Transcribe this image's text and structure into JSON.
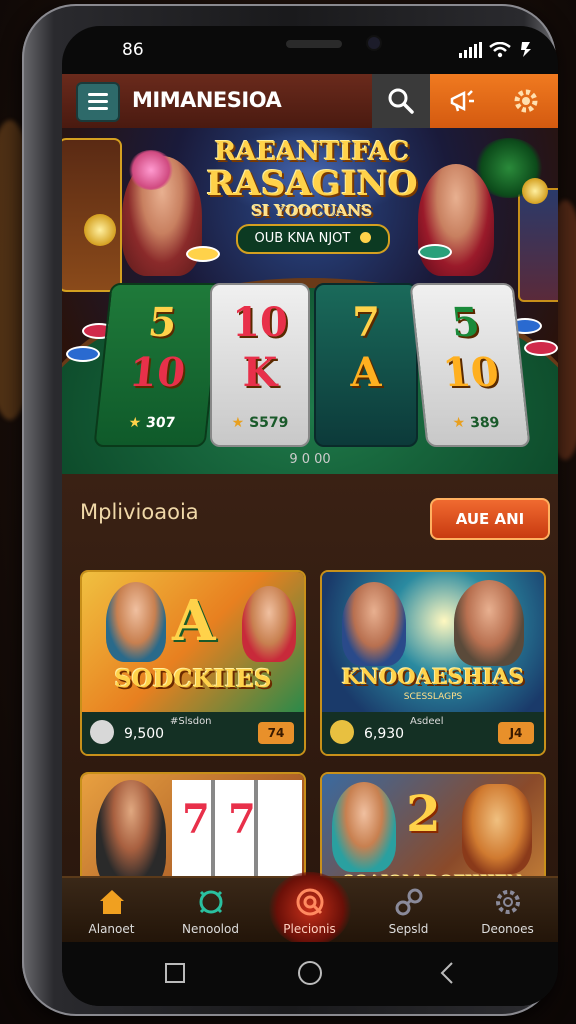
{
  "status_bar": {
    "time": "86"
  },
  "top_bar": {
    "title": "MIMANESIOA",
    "icons": [
      "menu-icon",
      "search-icon",
      "notification-icon",
      "gear-icon"
    ]
  },
  "banner": {
    "title_line1": "RAEANTIFAC",
    "title_line2": "RASAGINO",
    "title_line3": "SI YOOCUANS",
    "pill_text": "OUB KNA NJOT",
    "reels": [
      {
        "top": "5",
        "bottom": "10",
        "value": "307"
      },
      {
        "top": "10",
        "bottom": "K",
        "value": "S579"
      },
      {
        "top": "7",
        "bottom": "A",
        "value": ""
      },
      {
        "top": "5",
        "bottom": "10",
        "value": "389"
      }
    ],
    "pager_text": "9 0 00"
  },
  "section": {
    "title": "Mplivioaoia",
    "button_label": "AUE ANI"
  },
  "cards": [
    {
      "name": "SODCKIIES",
      "amount": "9,500",
      "label": "#Slsdon",
      "badge": "74"
    },
    {
      "name": "KNOOAESHIAS",
      "subtitle": "SCESSLAGPS",
      "amount": "6,930",
      "label": "Asdeel",
      "badge": "J4"
    },
    {
      "name": "",
      "amount": "",
      "label": "",
      "badge": ""
    },
    {
      "name": "SOAIOM DOFIHIEN",
      "amount": "",
      "label": "",
      "badge": ""
    }
  ],
  "bottom_nav": [
    {
      "label": "Alanoet",
      "icon": "home-icon",
      "active": false
    },
    {
      "label": "Nenoolod",
      "icon": "refresh-icon",
      "active": false
    },
    {
      "label": "Plecionis",
      "icon": "target-icon",
      "active": true
    },
    {
      "label": "Sepsld",
      "icon": "link-icon",
      "active": false
    },
    {
      "label": "Deonoes",
      "icon": "settings-icon",
      "active": false
    }
  ],
  "colors": {
    "accent_orange": "#f07a20",
    "gold": "#ffd24a",
    "felt_green": "#1f7a4a",
    "topbar_red": "#6a2a1c"
  }
}
